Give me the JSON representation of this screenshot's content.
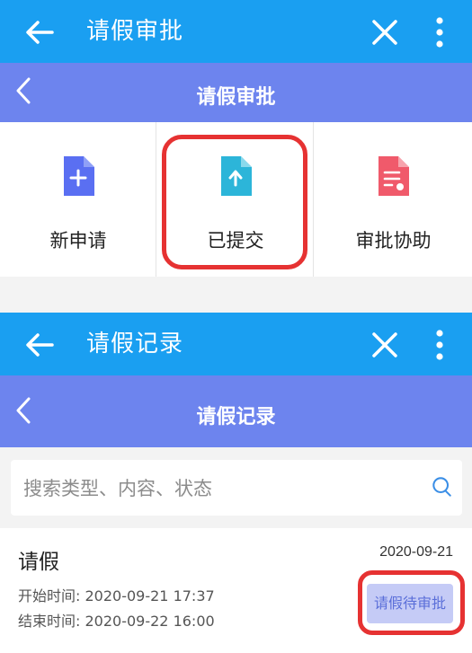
{
  "screen1": {
    "appbar": {
      "title": "请假审批",
      "back_icon": "arrow-left-icon",
      "close_icon": "close-icon",
      "more_icon": "more-vertical-icon"
    },
    "subbar": {
      "title": "请假审批",
      "back_icon": "chevron-left-icon"
    },
    "tiles": [
      {
        "label": "新申请",
        "icon": "new-document-icon",
        "color": "#5a6ff2"
      },
      {
        "label": "已提交",
        "icon": "upload-document-icon",
        "color": "#2cb5d9"
      },
      {
        "label": "审批协助",
        "icon": "approval-document-icon",
        "color": "#f05a6b"
      }
    ]
  },
  "screen2": {
    "appbar": {
      "title": "请假记录",
      "back_icon": "arrow-left-icon",
      "close_icon": "close-icon",
      "more_icon": "more-vertical-icon"
    },
    "subbar": {
      "title": "请假记录",
      "back_icon": "chevron-left-icon"
    },
    "search": {
      "placeholder": "搜索类型、内容、状态",
      "value": "",
      "icon": "search-icon"
    },
    "record": {
      "type": "请假",
      "date": "2020-09-21",
      "start_label": "开始时间:",
      "start_time": "2020-09-21 17:37",
      "end_label": "结束时间:",
      "end_time": "2020-09-22 16:00",
      "status": "请假待审批"
    }
  },
  "colors": {
    "appbar": "#1a9ff1",
    "subbar": "#6d84ee",
    "highlight": "#e63232"
  }
}
